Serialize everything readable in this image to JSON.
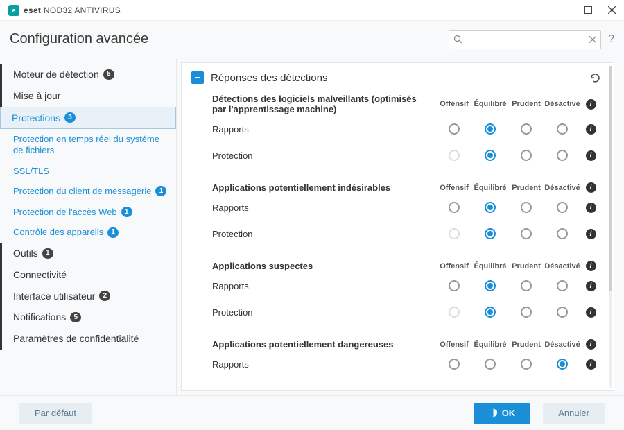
{
  "window": {
    "brand": "eset",
    "product": "NOD32 ANTIVIRUS"
  },
  "header": {
    "title": "Configuration avancée",
    "search_placeholder": "",
    "help": "?"
  },
  "sidebar": [
    {
      "label": "Moteur de détection",
      "badge": "5",
      "type": "top"
    },
    {
      "label": "Mise à jour",
      "type": "top"
    },
    {
      "label": "Protections",
      "badge": "3",
      "type": "active"
    },
    {
      "label": "Protection en temps réel du système de fichiers",
      "type": "sub"
    },
    {
      "label": "SSL/TLS",
      "type": "sub"
    },
    {
      "label": "Protection du client de messagerie",
      "badge": "1",
      "type": "sub"
    },
    {
      "label": "Protection de l'accès Web",
      "badge": "1",
      "type": "sub"
    },
    {
      "label": "Contrôle des appareils",
      "badge": "1",
      "type": "sub"
    },
    {
      "label": "Outils",
      "badge": "1",
      "type": "top"
    },
    {
      "label": "Connectivité",
      "type": "top"
    },
    {
      "label": "Interface utilisateur",
      "badge": "2",
      "type": "top"
    },
    {
      "label": "Notifications",
      "badge": "5",
      "type": "top"
    },
    {
      "label": "Paramètres de confidentialité",
      "type": "top"
    }
  ],
  "content": {
    "section_title": "Réponses des détections",
    "col_headers": [
      "Offensif",
      "Équilibré",
      "Prudent",
      "Désactivé"
    ],
    "groups": [
      {
        "title": "Détections des logiciels malveillants (optimisés par l'apprentissage machine)",
        "rows": [
          {
            "label": "Rapports",
            "checked": 1,
            "disabled": []
          },
          {
            "label": "Protection",
            "checked": 1,
            "disabled": [
              0
            ]
          }
        ]
      },
      {
        "title": "Applications potentiellement indésirables",
        "rows": [
          {
            "label": "Rapports",
            "checked": 1,
            "disabled": []
          },
          {
            "label": "Protection",
            "checked": 1,
            "disabled": [
              0
            ]
          }
        ]
      },
      {
        "title": "Applications suspectes",
        "rows": [
          {
            "label": "Rapports",
            "checked": 1,
            "disabled": []
          },
          {
            "label": "Protection",
            "checked": 1,
            "disabled": [
              0
            ]
          }
        ]
      },
      {
        "title": "Applications potentiellement dangereuses",
        "rows": [
          {
            "label": "Rapports",
            "checked": 3,
            "disabled": []
          }
        ]
      }
    ]
  },
  "footer": {
    "default": "Par défaut",
    "ok": "OK",
    "cancel": "Annuler"
  }
}
